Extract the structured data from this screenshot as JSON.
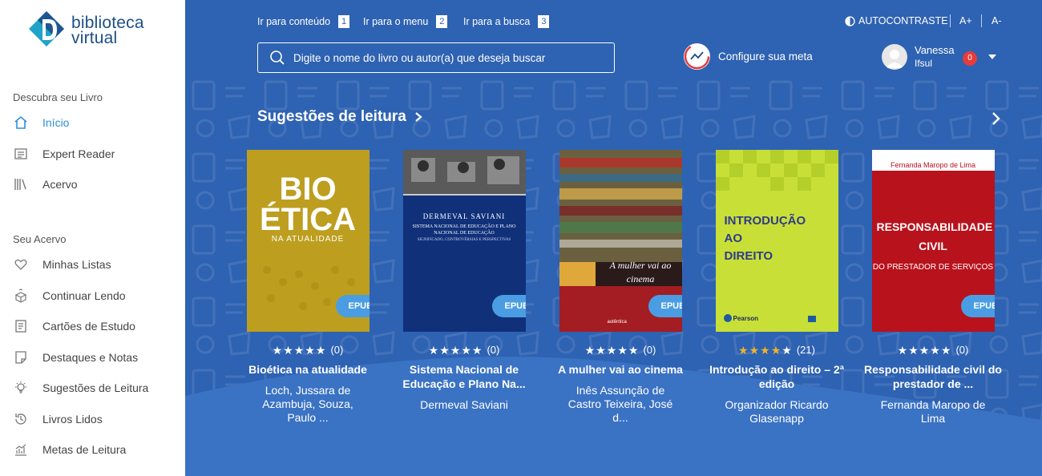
{
  "brand": {
    "line1": "biblioteca",
    "line2": "virtual"
  },
  "sidebar": {
    "section1": "Descubra seu Livro",
    "section2": "Seu Acervo",
    "items": [
      {
        "label": "Início",
        "icon": "home-icon"
      },
      {
        "label": "Expert Reader",
        "icon": "expert-reader-icon"
      },
      {
        "label": "Acervo",
        "icon": "library-icon"
      },
      {
        "label": "Minhas Listas",
        "icon": "heart-icon"
      },
      {
        "label": "Continuar Lendo",
        "icon": "book-stack-icon"
      },
      {
        "label": "Cartões de Estudo",
        "icon": "card-icon"
      },
      {
        "label": "Destaques e Notas",
        "icon": "note-icon"
      },
      {
        "label": "Sugestões de Leitura",
        "icon": "lightbulb-icon"
      },
      {
        "label": "Livros Lidos",
        "icon": "history-icon"
      },
      {
        "label": "Metas de Leitura",
        "icon": "chart-icon"
      }
    ]
  },
  "skip_links": [
    {
      "label": "Ir para conteúdo",
      "key": "1"
    },
    {
      "label": "Ir para o menu",
      "key": "2"
    },
    {
      "label": "Ir para a busca",
      "key": "3"
    }
  ],
  "accessibility": {
    "contrast": "AUTOCONTRASTE",
    "increase": "A+",
    "decrease": "A-"
  },
  "search": {
    "placeholder": "Digite o nome do livro ou autor(a) que deseja buscar"
  },
  "goal": {
    "label": "Configure sua meta"
  },
  "user": {
    "name": "Vanessa",
    "org": "Ifsul",
    "notifications": "0"
  },
  "section": {
    "title": "Sugestões de leitura"
  },
  "books": [
    {
      "title": "Bioética na atualidade",
      "author": "Loch, Jussara de Azambuja, Souza, Paulo ...",
      "reviews": "(0)",
      "stars": 0,
      "format": "EPUB",
      "cover_title": "BIO ÉTICA",
      "cover_subtitle": "NA ATUALIDADE"
    },
    {
      "title": "Sistema Nacional de Educação e Plano Na...",
      "author": "Dermeval Saviani",
      "reviews": "(0)",
      "stars": 0,
      "format": "EPUB",
      "cover_author": "DERMEVAL SAVIANI",
      "cover_title": "SISTEMA NACIONAL DE EDUCAÇÃO E PLANO NACIONAL DE EDUCAÇÃO",
      "cover_subtitle": "SIGNIFICADO, CONTROVÉRSIAS E PERSPECTIVAS"
    },
    {
      "title": "A mulher vai ao cinema",
      "author": "Inês Assunção de Castro Teixeira, José d...",
      "reviews": "(0)",
      "stars": 0,
      "format": "EPUB",
      "cover_title": "A mulher vai ao cinema",
      "cover_publisher": "autêntica"
    },
    {
      "title": "Introdução ao direito – 2ª edição",
      "author": "Organizador Ricardo Glasenapp",
      "reviews": "(21)",
      "stars": 4,
      "format": "",
      "cover_title": "INTRODUÇÃO AO DIREITO",
      "cover_publisher": "Pearson"
    },
    {
      "title": "Responsabilidade civil do prestador de ...",
      "author": "Fernanda Maropo de Lima",
      "reviews": "(0)",
      "stars": 0,
      "format": "EPUB",
      "cover_author": "Fernanda Maropo de Lima",
      "cover_title": "RESPONSABILIDADE CIVIL",
      "cover_subtitle": "DO PRESTADOR DE SERVIÇOS"
    }
  ],
  "colors": {
    "main_bg": "#2e62b2",
    "accent": "#2f8fd8",
    "star_filled": "#f0b429",
    "badge": "#e63c3c"
  }
}
